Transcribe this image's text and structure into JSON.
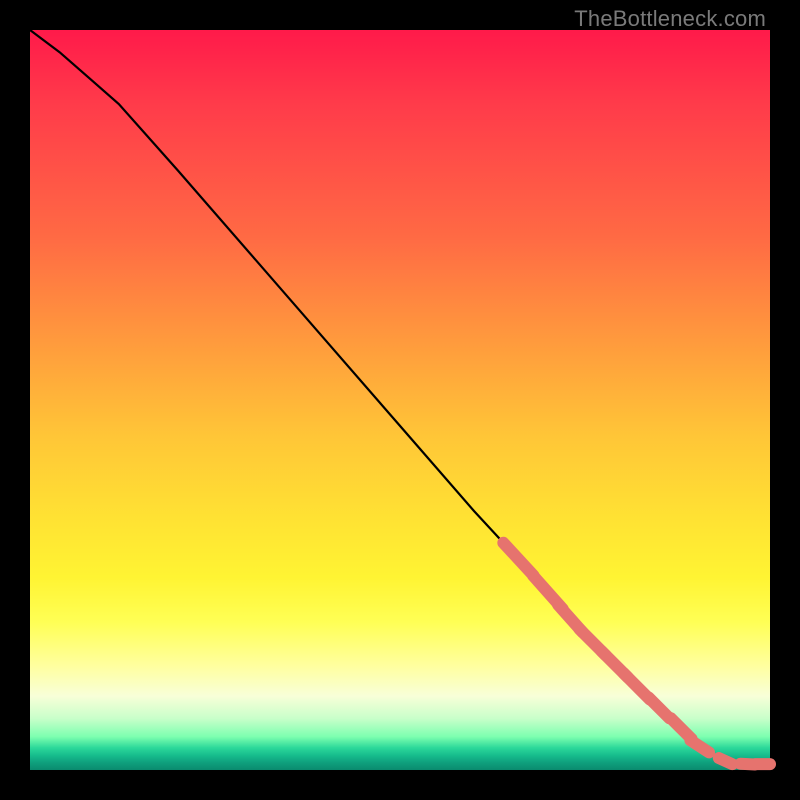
{
  "watermark": "TheBottleneck.com",
  "chart_data": {
    "type": "line",
    "title": "",
    "xlabel": "",
    "ylabel": "",
    "xlim": [
      0,
      100
    ],
    "ylim": [
      0,
      100
    ],
    "grid": false,
    "legend": false,
    "background": "gradient-red-yellow-green",
    "series": [
      {
        "name": "curve",
        "x": [
          0,
          4,
          8,
          12,
          20,
          30,
          40,
          50,
          60,
          66,
          70,
          74,
          78,
          82,
          86,
          88,
          90,
          92,
          94,
          96,
          98,
          100
        ],
        "y": [
          100,
          97,
          93.5,
          90,
          81,
          69.5,
          58,
          46.5,
          35,
          28.5,
          24,
          19.5,
          15.5,
          11.5,
          7.5,
          5.5,
          3.5,
          2.2,
          1.3,
          0.9,
          0.8,
          0.8
        ]
      }
    ],
    "markers": [
      {
        "cx": 66,
        "cy": 28.5,
        "len": 6
      },
      {
        "cx": 70,
        "cy": 24,
        "len": 6
      },
      {
        "cx": 73,
        "cy": 20.5,
        "len": 5
      },
      {
        "cx": 76,
        "cy": 17.3,
        "len": 5
      },
      {
        "cx": 79,
        "cy": 14.3,
        "len": 5
      },
      {
        "cx": 82,
        "cy": 11.3,
        "len": 5
      },
      {
        "cx": 85,
        "cy": 8.4,
        "len": 4
      },
      {
        "cx": 88,
        "cy": 5.6,
        "len": 4
      },
      {
        "cx": 90.5,
        "cy": 3.2,
        "len": 3
      },
      {
        "cx": 94,
        "cy": 1.2,
        "len": 2
      },
      {
        "cx": 97,
        "cy": 0.8,
        "len": 2
      },
      {
        "cx": 99,
        "cy": 0.8,
        "len": 2
      }
    ],
    "marker_color": "#e6736e",
    "curve_color": "#000000"
  }
}
